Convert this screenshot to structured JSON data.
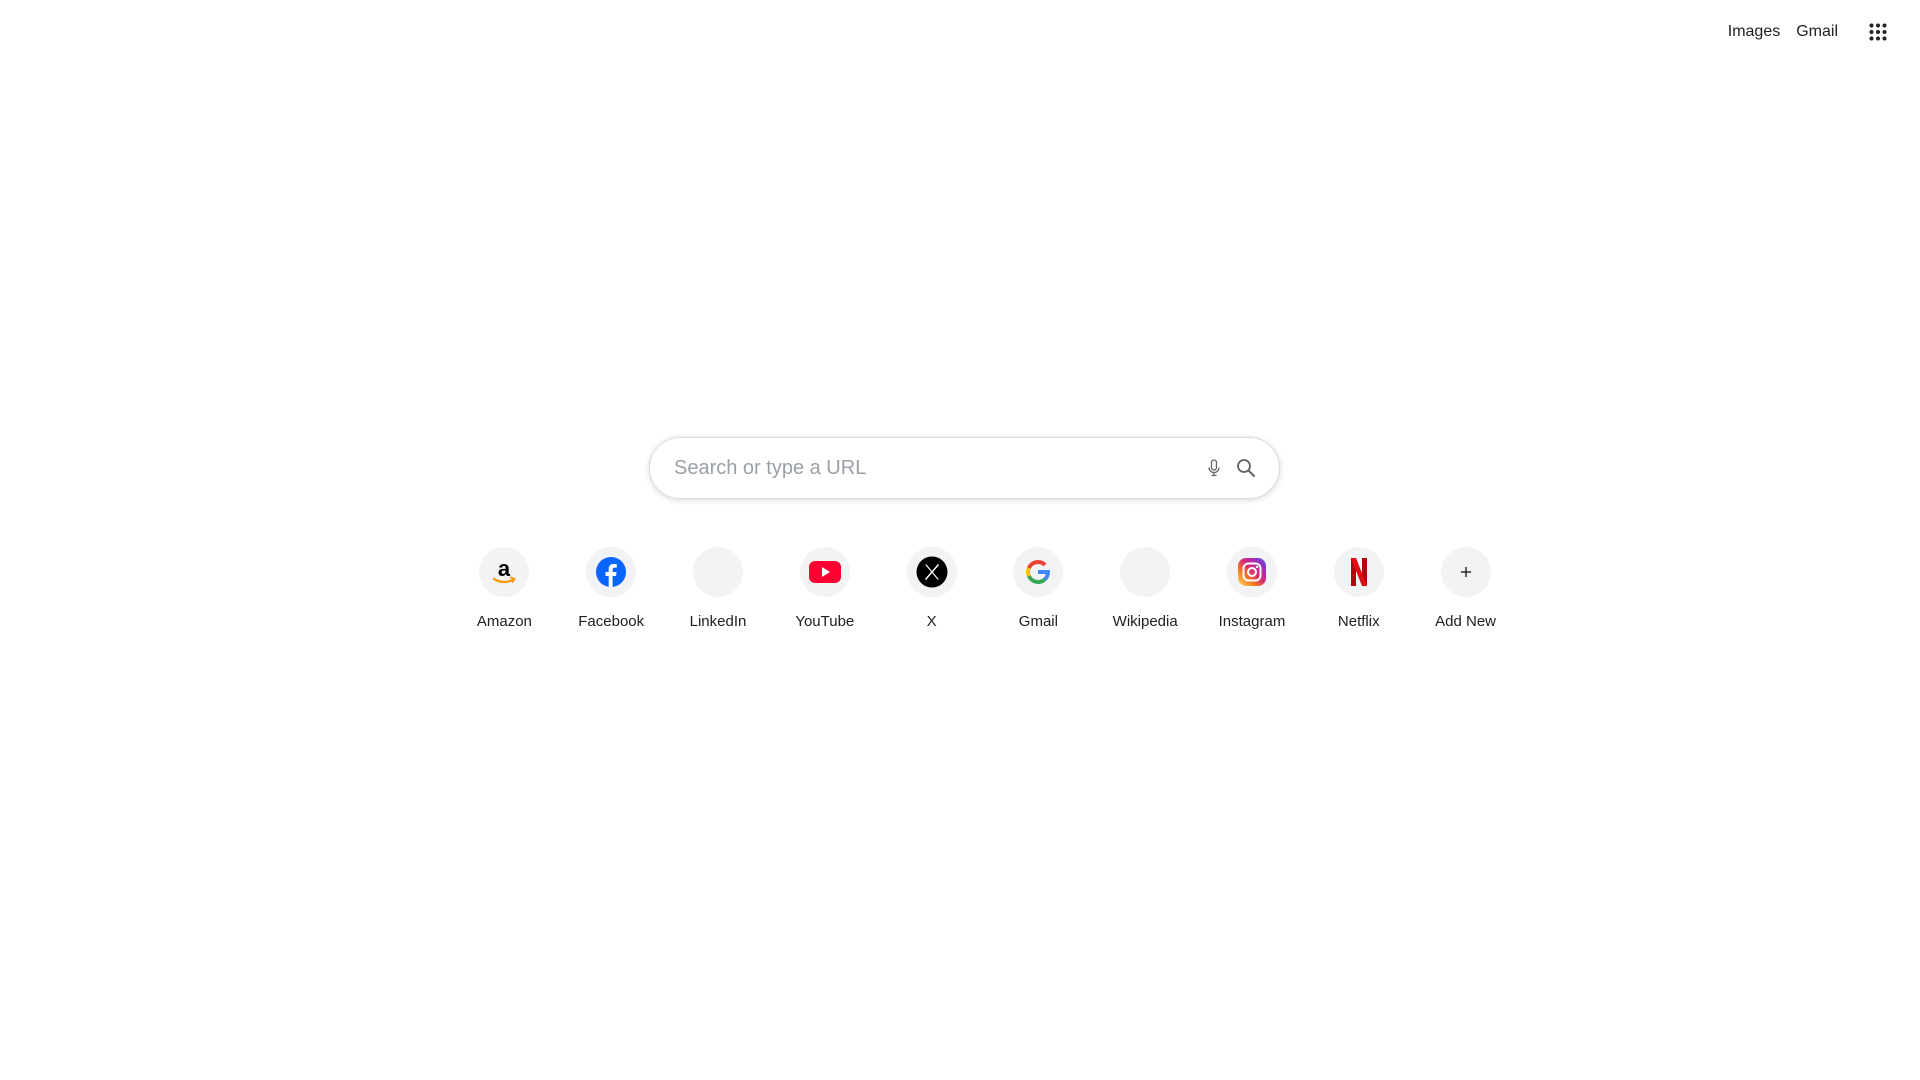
{
  "header": {
    "images_label": "Images",
    "gmail_label": "Gmail",
    "apps_icon": "apps-grid-icon"
  },
  "search": {
    "placeholder": "Search or type a URL",
    "value": "",
    "mic_icon": "microphone-icon",
    "search_icon": "search-icon"
  },
  "shortcuts": [
    {
      "label": "Amazon",
      "icon": "amazon-icon"
    },
    {
      "label": "Facebook",
      "icon": "facebook-icon",
      "color": "#0866ff"
    },
    {
      "label": "LinkedIn",
      "icon": "linkedin-icon"
    },
    {
      "label": "YouTube",
      "icon": "youtube-icon",
      "color": "#ff0033"
    },
    {
      "label": "X",
      "icon": "x-icon",
      "color": "#000000"
    },
    {
      "label": "Gmail",
      "icon": "google-icon"
    },
    {
      "label": "Wikipedia",
      "icon": "wikipedia-icon"
    },
    {
      "label": "Instagram",
      "icon": "instagram-icon"
    },
    {
      "label": "Netflix",
      "icon": "netflix-icon",
      "color": "#e50914"
    },
    {
      "label": "Add New",
      "icon": "plus-icon"
    }
  ]
}
